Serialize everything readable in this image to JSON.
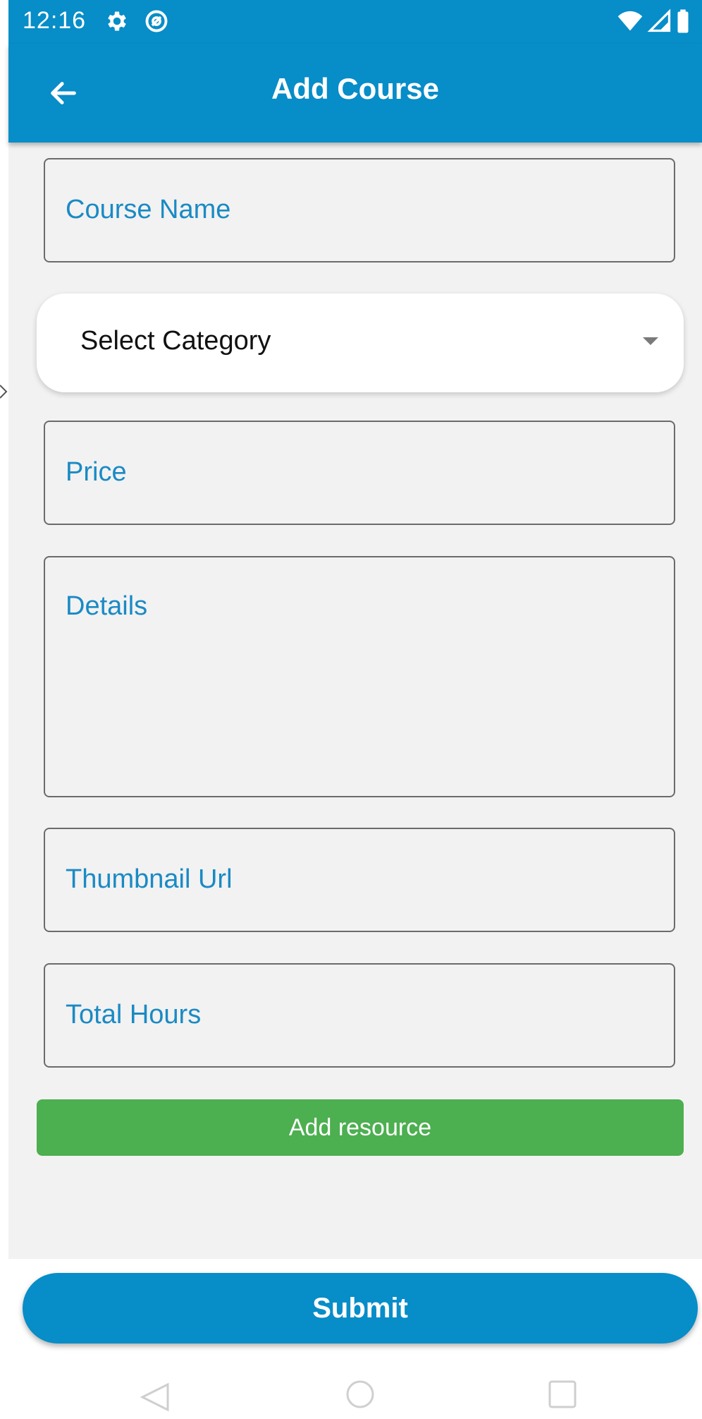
{
  "status_bar": {
    "time": "12:16",
    "icons": [
      "gear-icon",
      "at-sign-icon",
      "wifi-icon",
      "signal-icon",
      "battery-icon"
    ]
  },
  "app_bar": {
    "title": "Add Course",
    "back_icon": "arrow-left-icon"
  },
  "form": {
    "course_name_placeholder": "Course Name",
    "category_select": {
      "selected": "Select Category",
      "caret_icon": "caret-down-icon"
    },
    "price_placeholder": "Price",
    "details_placeholder": "Details",
    "thumbnail_placeholder": "Thumbnail Url",
    "total_hours_placeholder": "Total Hours",
    "add_resource_label": "Add resource"
  },
  "submit_label": "Submit",
  "colors": {
    "primary": "#078dc8",
    "success": "#4caf50",
    "label": "#1a8ac4",
    "form_background": "#f2f2f2"
  },
  "nav_bar": {
    "icons": [
      "back-triangle-icon",
      "home-circle-icon",
      "recents-square-icon"
    ]
  }
}
